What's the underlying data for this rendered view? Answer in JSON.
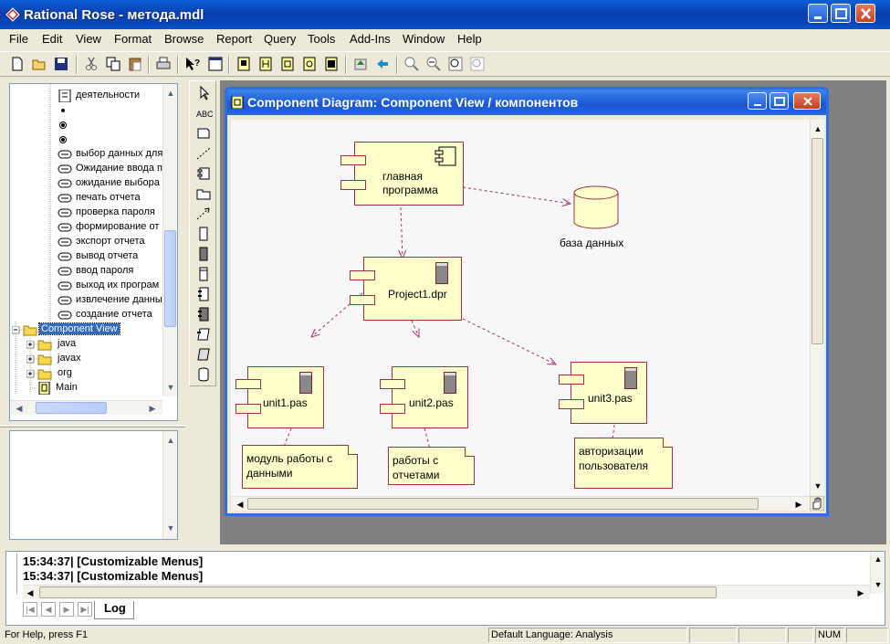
{
  "window": {
    "title": "Rational Rose - метода.mdl"
  },
  "menu": [
    "File",
    "Edit",
    "View",
    "Format",
    "Browse",
    "Report",
    "Query",
    "Tools",
    "Add-Ins",
    "Window",
    "Help"
  ],
  "browser": {
    "items": [
      {
        "label": "деятельности",
        "icon": "activity-icon"
      },
      {
        "label": "",
        "icon": "start-state-icon"
      },
      {
        "label": "",
        "icon": "end-state-icon"
      },
      {
        "label": "",
        "icon": "end-state-icon"
      },
      {
        "label": "выбор данных для",
        "icon": "activity-state-icon"
      },
      {
        "label": "Ожидание ввода п",
        "icon": "activity-state-icon"
      },
      {
        "label": "ожидание выбора",
        "icon": "activity-state-icon"
      },
      {
        "label": "печать отчета",
        "icon": "activity-state-icon"
      },
      {
        "label": "проверка пароля",
        "icon": "activity-state-icon"
      },
      {
        "label": "формирование от",
        "icon": "activity-state-icon"
      },
      {
        "label": "экспорт отчета",
        "icon": "activity-state-icon"
      },
      {
        "label": "вывод отчета",
        "icon": "activity-state-icon"
      },
      {
        "label": "ввод пароля",
        "icon": "activity-state-icon"
      },
      {
        "label": "выход их програм",
        "icon": "activity-state-icon"
      },
      {
        "label": "извлечение данны",
        "icon": "activity-state-icon"
      },
      {
        "label": "создание отчета",
        "icon": "activity-state-icon"
      }
    ],
    "component_view": "Component View",
    "packages": [
      "java",
      "javax",
      "org"
    ],
    "main": "Main"
  },
  "diagram": {
    "title": "Component Diagram: Component View / компонентов",
    "components": {
      "main_program": "главная\nпрограмма",
      "database": "база данных",
      "project": "Project1.dpr",
      "unit1": "unit1.pas",
      "unit2": "unit2.pas",
      "unit3": "unit3.pas"
    },
    "notes": {
      "note1": "модуль работы с\nданными",
      "note2": "работы с\nотчетами",
      "note3": "авторизации\nпользователя"
    }
  },
  "log": {
    "lines": [
      "15:34:37|  [Customizable Menus]",
      "15:34:37|  [Customizable Menus]"
    ],
    "tab": "Log"
  },
  "status": {
    "help": "For Help, press F1",
    "language": "Default Language: Analysis",
    "num": "NUM"
  },
  "colors": {
    "component_fill": "#ffffcc",
    "component_border": "#a0304a",
    "arrow": "#a0306a"
  }
}
